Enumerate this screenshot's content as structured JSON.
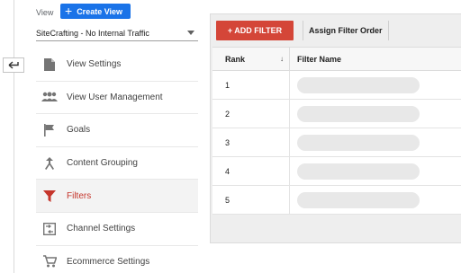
{
  "header": {
    "view_label": "View",
    "create_view_label": "Create View",
    "selected_view": "SiteCrafting - No Internal Traffic"
  },
  "sidebar": {
    "items": [
      {
        "label": "View Settings",
        "icon": "document-icon",
        "active": false
      },
      {
        "label": "View User Management",
        "icon": "users-icon",
        "active": false
      },
      {
        "label": "Goals",
        "icon": "flag-icon",
        "active": false
      },
      {
        "label": "Content Grouping",
        "icon": "merge-icon",
        "active": false
      },
      {
        "label": "Filters",
        "icon": "funnel-icon",
        "active": true
      },
      {
        "label": "Channel Settings",
        "icon": "channel-icon",
        "active": false
      },
      {
        "label": "Ecommerce Settings",
        "icon": "cart-icon",
        "active": false
      }
    ]
  },
  "toolbar": {
    "add_filter_label": "+ ADD FILTER",
    "assign_order_label": "Assign Filter Order"
  },
  "table": {
    "columns": [
      "Rank",
      "Filter Name"
    ],
    "sort_indicator": "↓",
    "rows": [
      {
        "rank": "1"
      },
      {
        "rank": "2"
      },
      {
        "rank": "3"
      },
      {
        "rank": "4"
      },
      {
        "rank": "5"
      }
    ]
  },
  "colors": {
    "accent_blue": "#1a73e8",
    "add_filter_red": "#d44638",
    "active_item_red": "#c5352b"
  }
}
